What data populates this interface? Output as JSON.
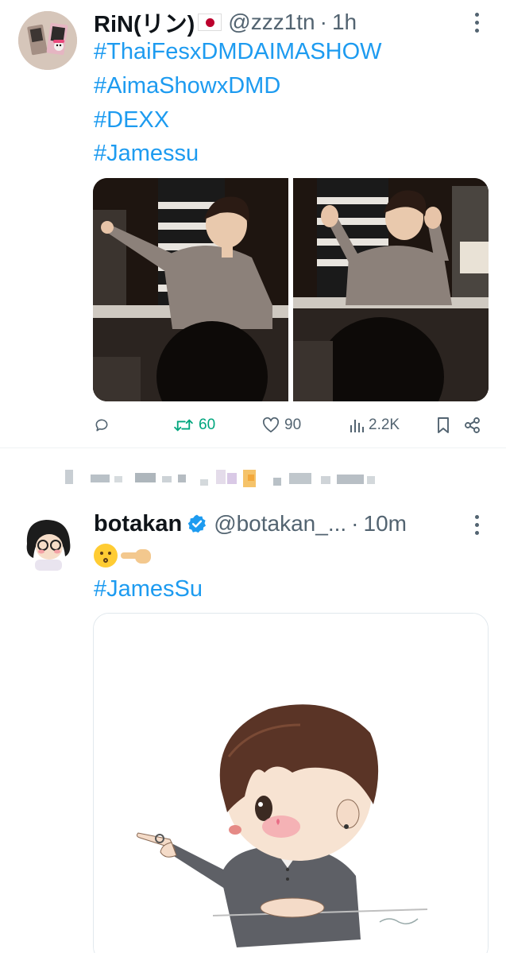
{
  "tweet1": {
    "display_name": "RiN(リン)",
    "flag": "🇯🇵",
    "handle": "@zzz1tn",
    "time": "1h",
    "hashtags": [
      "#ThaiFesxDMDAIMASHOW",
      "#AimaShowxDMD",
      "#DEXX",
      "#Jamessu"
    ],
    "actions": {
      "replies": "",
      "retweets": "60",
      "likes": "90",
      "views": "2.2K"
    }
  },
  "tweet2": {
    "display_name": "botakan",
    "verified": true,
    "handle": "@botakan_...",
    "time": "10m",
    "emoji_text": "😗🫱",
    "hashtags": [
      "#JamesSu"
    ]
  },
  "colors": {
    "hashtag": "#1d9bf0",
    "secondary_text": "#536471",
    "retweet_active": "#00a67e",
    "verified": "#1d9bf0"
  },
  "icons": [
    "more-icon",
    "reply-icon",
    "retweet-icon",
    "like-icon",
    "views-icon",
    "bookmark-icon",
    "share-icon",
    "verified-badge-icon"
  ]
}
